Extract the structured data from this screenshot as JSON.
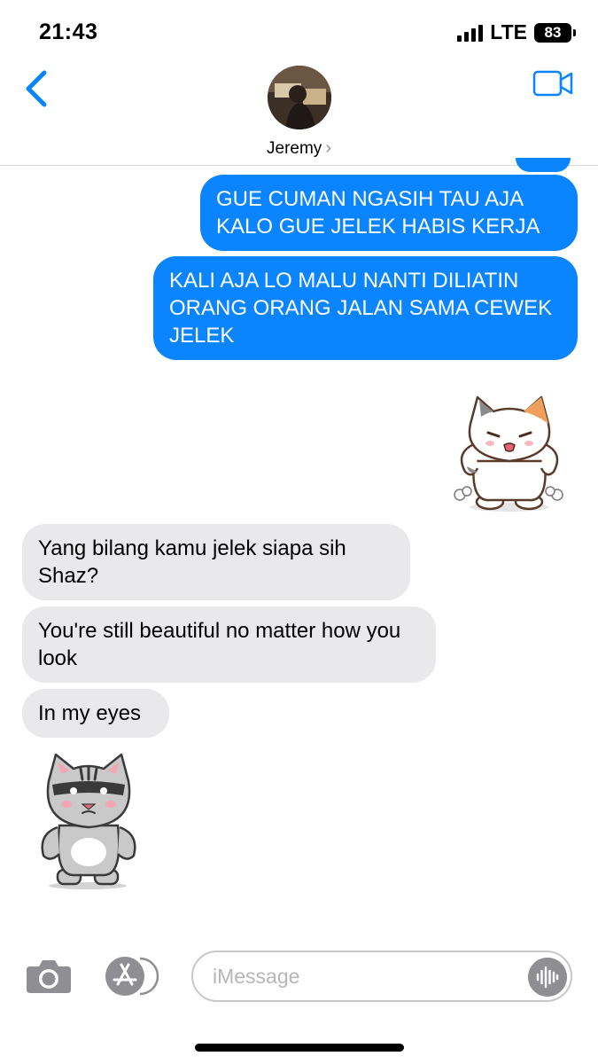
{
  "status_bar": {
    "time": "21:43",
    "network": "LTE",
    "battery": "83"
  },
  "header": {
    "contact_name": "Jeremy",
    "contact_chevron": "›",
    "back_icon": "chevron-left-icon",
    "video_icon": "video-camera-icon"
  },
  "colors": {
    "accent": "#0a84ff",
    "incoming_bubble": "#e9e9eb",
    "outgoing_text": "#ffffff"
  },
  "messages": [
    {
      "direction": "outgoing",
      "text": "GUE CUMAN NGASIH TAU AJA KALO GUE JELEK HABIS KERJA"
    },
    {
      "direction": "outgoing",
      "text": "KALI AJA LO MALU NANTI DILIATIN ORANG ORANG JALAN SAMA CEWEK JELEK"
    },
    {
      "direction": "outgoing",
      "sticker": "angry-calico-cat-sticker"
    },
    {
      "direction": "incoming",
      "text": "Yang bilang kamu jelek siapa sih Shaz?"
    },
    {
      "direction": "incoming",
      "text": "You're still beautiful no matter how you look"
    },
    {
      "direction": "incoming",
      "text": "In my eyes"
    },
    {
      "direction": "incoming",
      "sticker": "grumpy-grey-cat-sticker"
    }
  ],
  "input_bar": {
    "placeholder": "iMessage",
    "value": "",
    "camera_icon": "camera-icon",
    "apps_icon": "app-store-icon",
    "audio_icon": "audio-waveform-icon"
  }
}
